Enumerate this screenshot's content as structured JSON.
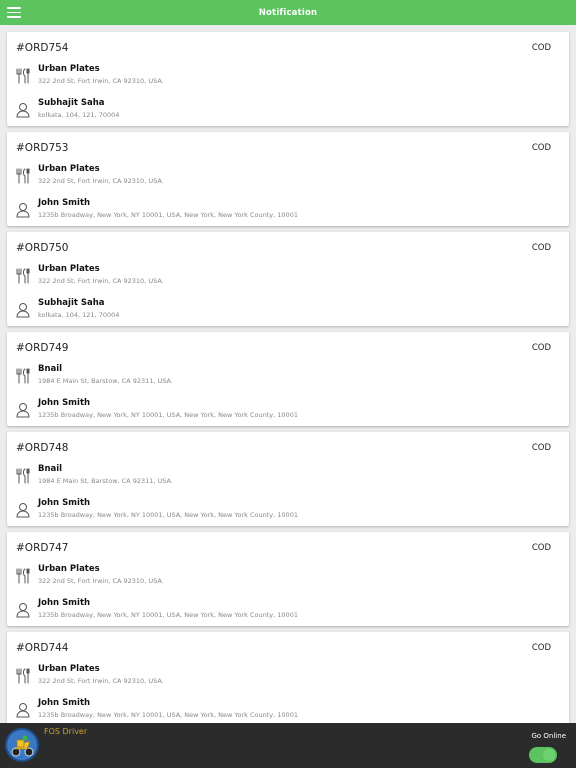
{
  "header": {
    "title": "Notification"
  },
  "orders": [
    {
      "id": "#ORD754",
      "payment": "COD",
      "restaurant": {
        "name": "Urban Plates",
        "address": "322 2nd St, Fort Irwin, CA 92310, USA."
      },
      "customer": {
        "name": "Subhajit Saha",
        "address": "kolkata, 104, 121, 70004"
      }
    },
    {
      "id": "#ORD753",
      "payment": "COD",
      "restaurant": {
        "name": "Urban Plates",
        "address": "322 2nd St, Fort Irwin, CA 92310, USA."
      },
      "customer": {
        "name": "John Smith",
        "address": "1235b Broadway, New York, NY 10001, USA, New York, New York County, 10001"
      }
    },
    {
      "id": "#ORD750",
      "payment": "COD",
      "restaurant": {
        "name": "Urban Plates",
        "address": "322 2nd St, Fort Irwin, CA 92310, USA."
      },
      "customer": {
        "name": "Subhajit Saha",
        "address": "kolkata, 104, 121, 70004"
      }
    },
    {
      "id": "#ORD749",
      "payment": "COD",
      "restaurant": {
        "name": "Bnail",
        "address": "1984 E Main St, Barstow, CA 92311, USA."
      },
      "customer": {
        "name": "John Smith",
        "address": "1235b Broadway, New York, NY 10001, USA, New York, New York County, 10001"
      }
    },
    {
      "id": "#ORD748",
      "payment": "COD",
      "restaurant": {
        "name": "Bnail",
        "address": "1984 E Main St, Barstow, CA 92311, USA."
      },
      "customer": {
        "name": "John Smith",
        "address": "1235b Broadway, New York, NY 10001, USA, New York, New York County, 10001"
      }
    },
    {
      "id": "#ORD747",
      "payment": "COD",
      "restaurant": {
        "name": "Urban Plates",
        "address": "322 2nd St, Fort Irwin, CA 92310, USA."
      },
      "customer": {
        "name": "John Smith",
        "address": "1235b Broadway, New York, NY 10001, USA, New York, New York County, 10001"
      }
    },
    {
      "id": "#ORD744",
      "payment": "COD",
      "restaurant": {
        "name": "Urban Plates",
        "address": "322 2nd St, Fort Irwin, CA 92310, USA."
      },
      "customer": {
        "name": "John Smith",
        "address": "1235b Broadway, New York, NY 10001, USA, New York, New York County, 10001"
      }
    }
  ],
  "icons": {
    "menu": "hamburger-menu-icon",
    "restaurant": "fork-knife-icon",
    "customer": "user-icon"
  },
  "footer": {
    "driver_name": "FOS Driver",
    "go_online_label": "Go Online",
    "online": true
  },
  "colors": {
    "accent": "#5cc45e",
    "footer_bg": "#2b2b2b",
    "driver_name": "#c9a02a"
  }
}
